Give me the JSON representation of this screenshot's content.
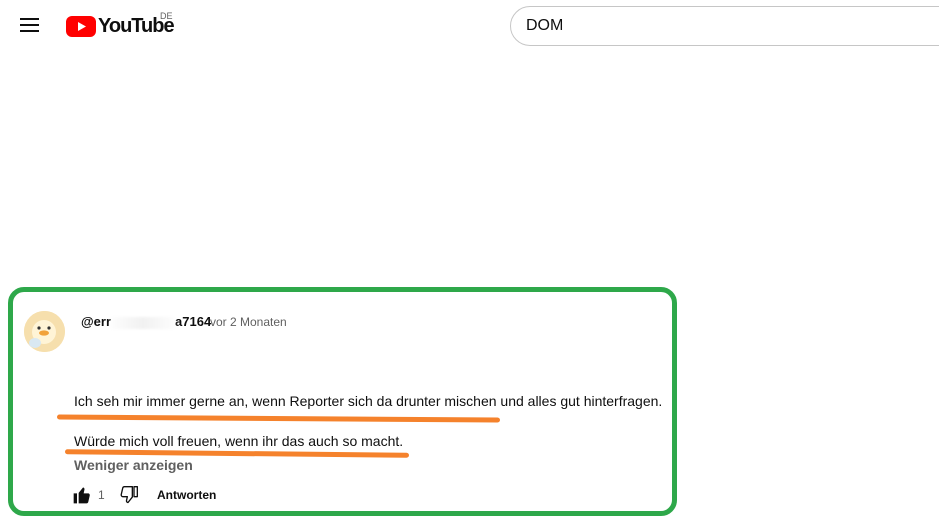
{
  "header": {
    "logo_text": "YouTube",
    "region_code": "DE",
    "search_value": "DOM",
    "brand_color": "#ff0000"
  },
  "comment": {
    "author_visible_start": "@err",
    "author_visible_end": "a7164",
    "timestamp": "vor 2 Monaten",
    "line1": "Ich seh mir immer gerne an, wenn Reporter sich da drunter mischen und alles gut hinterfragen.",
    "line2": "Würde mich voll freuen, wenn ihr das auch so macht.",
    "show_less": "Weniger anzeigen",
    "like_count": "1",
    "reply_label": "Antworten",
    "highlight_box_color": "#2ea84a",
    "underline_color": "#f5822c"
  },
  "icons": {
    "menu": "menu-icon",
    "logo": "youtube-play-icon",
    "like": "thumbs-up-icon",
    "dislike": "thumbs-down-icon"
  }
}
